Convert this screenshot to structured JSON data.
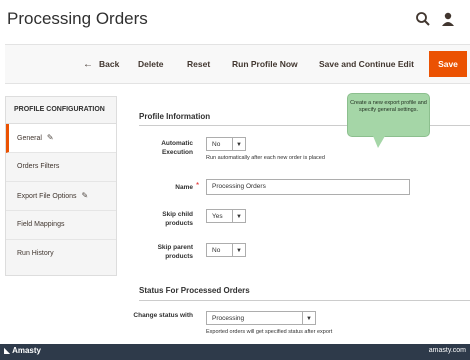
{
  "header": {
    "title": "Processing Orders"
  },
  "toolbar": {
    "back_label": "Back",
    "reset_label": "Reset",
    "delete_label": "Delete",
    "run_label": "Run Profile Now",
    "save_continue_label": "Save and Continue Edit",
    "save_label": "Save"
  },
  "sidebar": {
    "heading": "PROFILE CONFIGURATION",
    "items": [
      {
        "label": "General",
        "active": true
      },
      {
        "label": "Orders Filters"
      },
      {
        "label": "Export File Options"
      },
      {
        "label": "Field Mappings"
      },
      {
        "label": "Run History"
      }
    ]
  },
  "profile": {
    "section_title": "Profile Information",
    "auto_exec_label": "Automatic Execution",
    "auto_exec_value": "No",
    "auto_exec_note": "Run automatically after each new order is placed",
    "name_label": "Name",
    "name_value": "Processing Orders",
    "skip_child_label": "Skip child products",
    "skip_child_value": "Yes",
    "skip_parent_label": "Skip parent products",
    "skip_parent_value": "No"
  },
  "status_section": {
    "title": "Status For Processed Orders",
    "change_label": "Change status with",
    "change_value": "Processing",
    "change_note": "Exported orders will get specified status after export"
  },
  "tooltip": {
    "text": "Create a new export profile and specify general settings."
  },
  "footer": {
    "brand": "Amasty",
    "url": "amasty.com"
  },
  "colors": {
    "accent": "#eb5202",
    "tooltip": "#a5d6a7",
    "footer": "#2e3a4a"
  }
}
